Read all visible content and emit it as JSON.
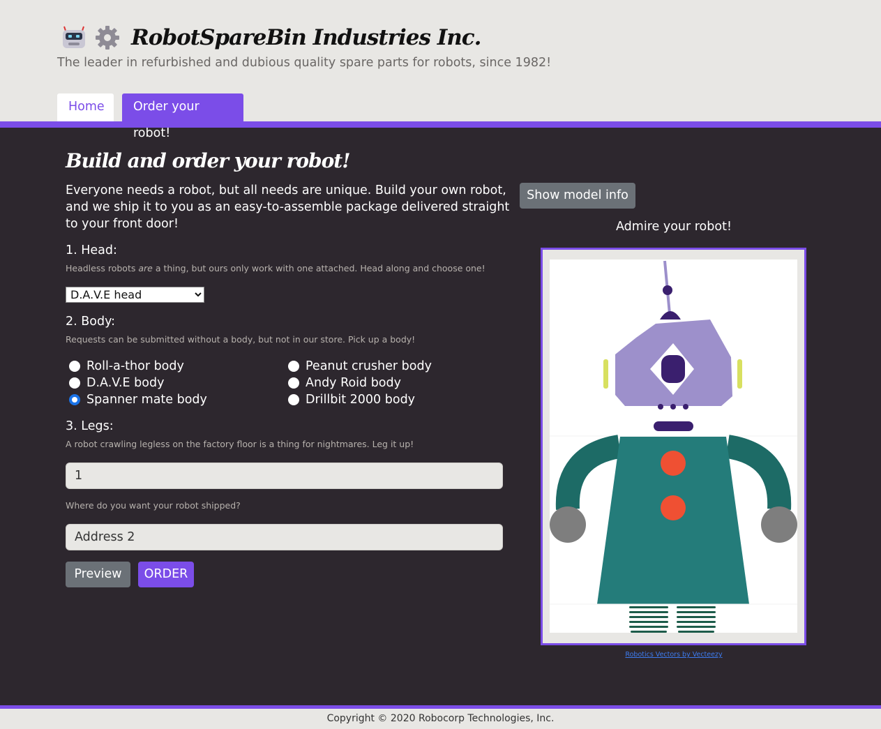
{
  "header": {
    "title": "RobotSpareBin Industries Inc.",
    "tagline": "The leader in refurbished and dubious quality spare parts for robots, since 1982!",
    "tabs": [
      "Home",
      "Order your robot!"
    ],
    "active_tab": "Order your robot!"
  },
  "main": {
    "title": "Build and order your robot!",
    "intro": "Everyone needs a robot, but all needs are unique. Build your own robot, and we ship it to you as an easy-to-assemble package delivered straight to your front door!",
    "head": {
      "label": "1. Head:",
      "hint_before": "Headless robots",
      "hint_em": "are",
      "hint_after": "a thing, but ours only work with one attached. Head along and choose one!",
      "selected": "D.A.V.E head"
    },
    "body": {
      "label": "2. Body:",
      "hint": "Requests can be submitted without a body, but not in our store. Pick up a body!",
      "options": [
        "Roll-a-thor body",
        "D.A.V.E body",
        "Spanner mate body",
        "Peanut crusher body",
        "Andy Roid body",
        "Drillbit 2000 body"
      ],
      "selected": "Spanner mate body"
    },
    "legs": {
      "label": "3. Legs:",
      "hint": "A robot crawling legless on the factory floor is a thing for nightmares. Leg it up!",
      "value": "1"
    },
    "address": {
      "hint": "Where do you want your robot shipped?",
      "value": "Address 2"
    },
    "buttons": {
      "preview": "Preview",
      "order": "ORDER"
    }
  },
  "side": {
    "model_info_button": "Show model info",
    "admire": "Admire your robot!",
    "credit": "Robotics Vectors by Vecteezy"
  },
  "footer": {
    "copyright": "Copyright © 2020 Robocorp Technologies, Inc."
  },
  "colors": {
    "accent": "#7b4de8",
    "header_bg": "#e8e7e4",
    "main_bg": "#2d272e",
    "secondary_button": "#6b7177"
  }
}
